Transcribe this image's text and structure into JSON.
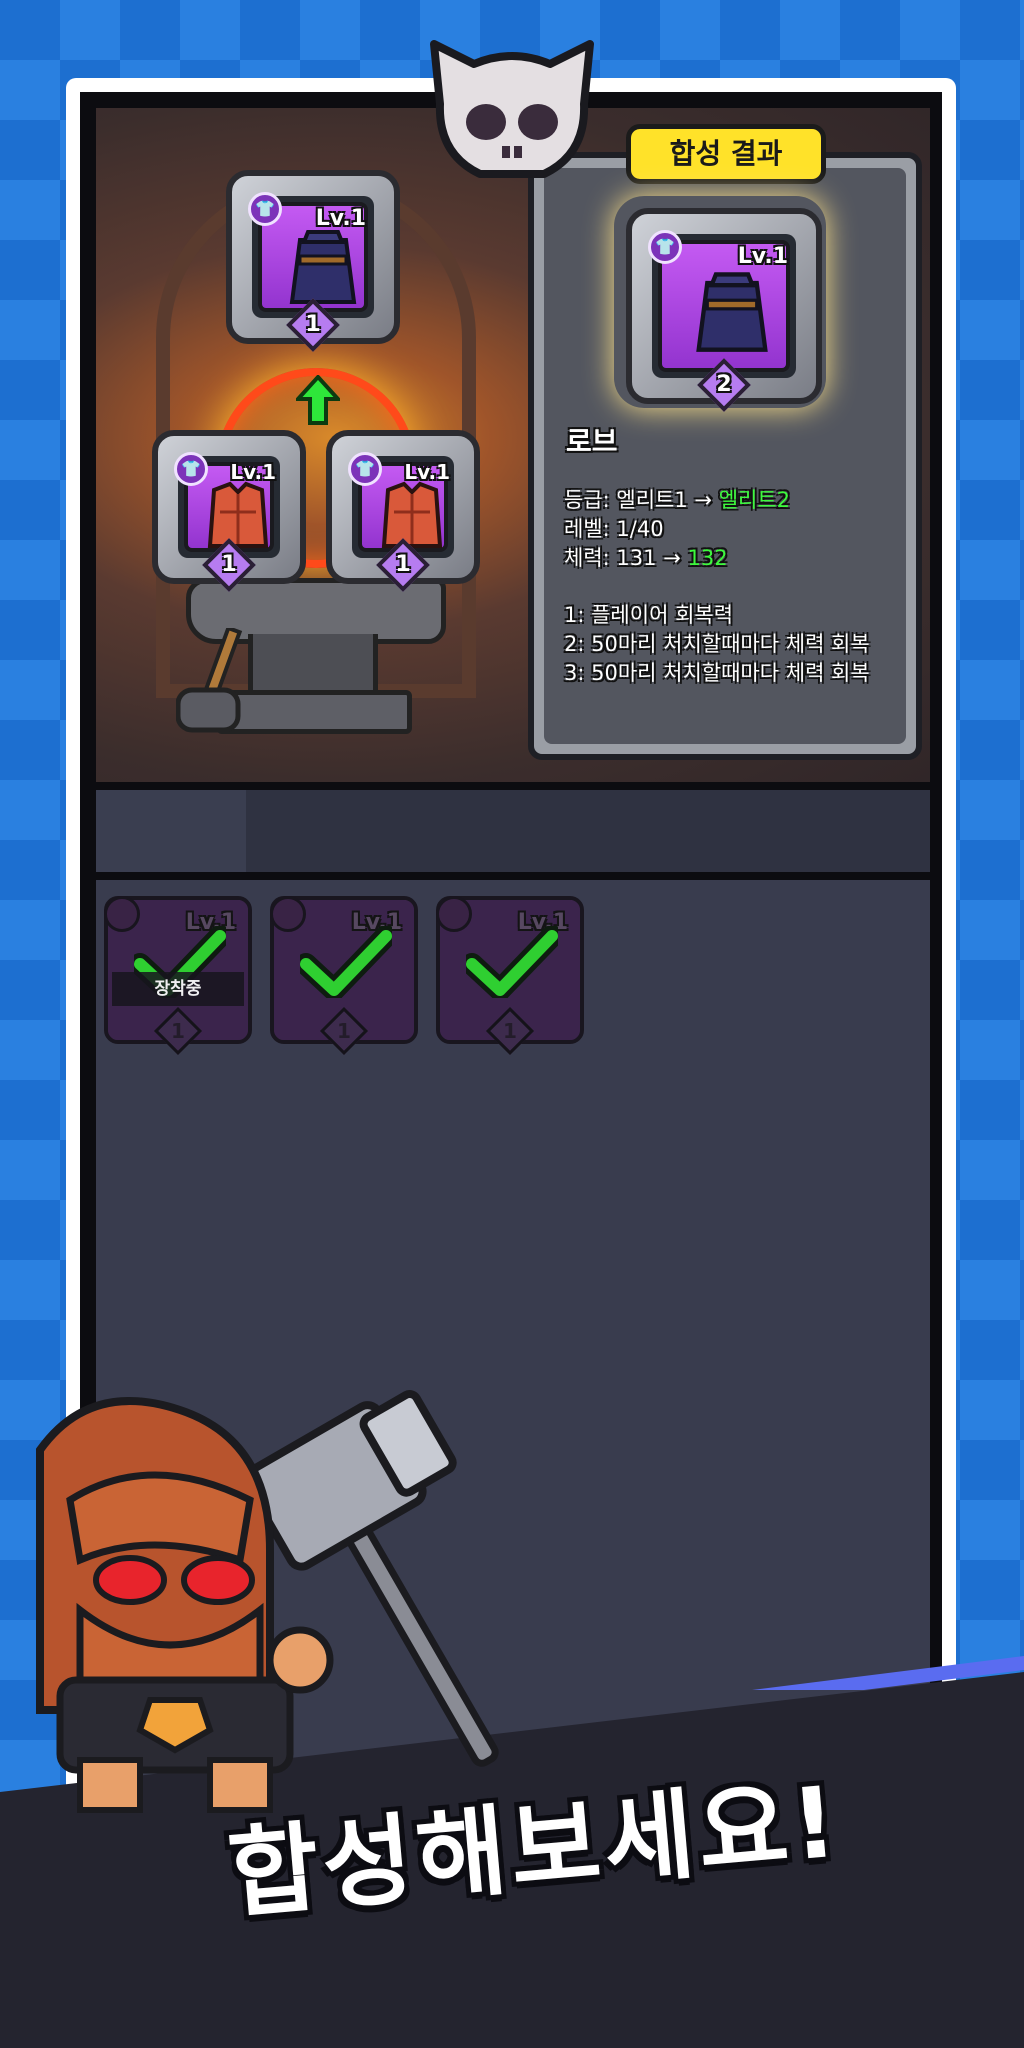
{
  "result_title": "합성 결과",
  "materials": {
    "top": {
      "level": "Lv.1",
      "count": "1",
      "item": "robe"
    },
    "left": {
      "level": "Lv.1",
      "count": "1",
      "item": "armor"
    },
    "right": {
      "level": "Lv.1",
      "count": "1",
      "item": "armor"
    }
  },
  "result": {
    "level": "Lv.1",
    "count": "2",
    "name": "로브",
    "grade_label": "등급:",
    "grade_from": "엘리트1",
    "grade_arrow": "→",
    "grade_to": "엘리트2",
    "level_label": "레벨:",
    "level_value": "1/40",
    "hp_label": "체력:",
    "hp_from": "131",
    "hp_arrow": "→",
    "hp_to": "132",
    "effects": [
      "1: 플레이어 회복력",
      "2: 50마리 처치할때마다 체력 회복",
      "3: 50마리 처치할때마다 체력 회복"
    ]
  },
  "inventory": [
    {
      "level": "Lv.1",
      "count": "1",
      "equipped_label": "장착중",
      "selected": true
    },
    {
      "level": "Lv.1",
      "count": "1",
      "selected": true
    },
    {
      "level": "Lv.1",
      "count": "1",
      "selected": true
    }
  ],
  "headline": "합성해보세요!",
  "colors": {
    "background": "#1d6fd0",
    "accent_yellow": "#ffe229",
    "increase_green": "#3dfa3d",
    "card_purple": "#a53fdc"
  },
  "icons": [
    "skull-icon",
    "shirt-icon",
    "up-arrow-icon",
    "check-icon",
    "hammer-icon"
  ]
}
